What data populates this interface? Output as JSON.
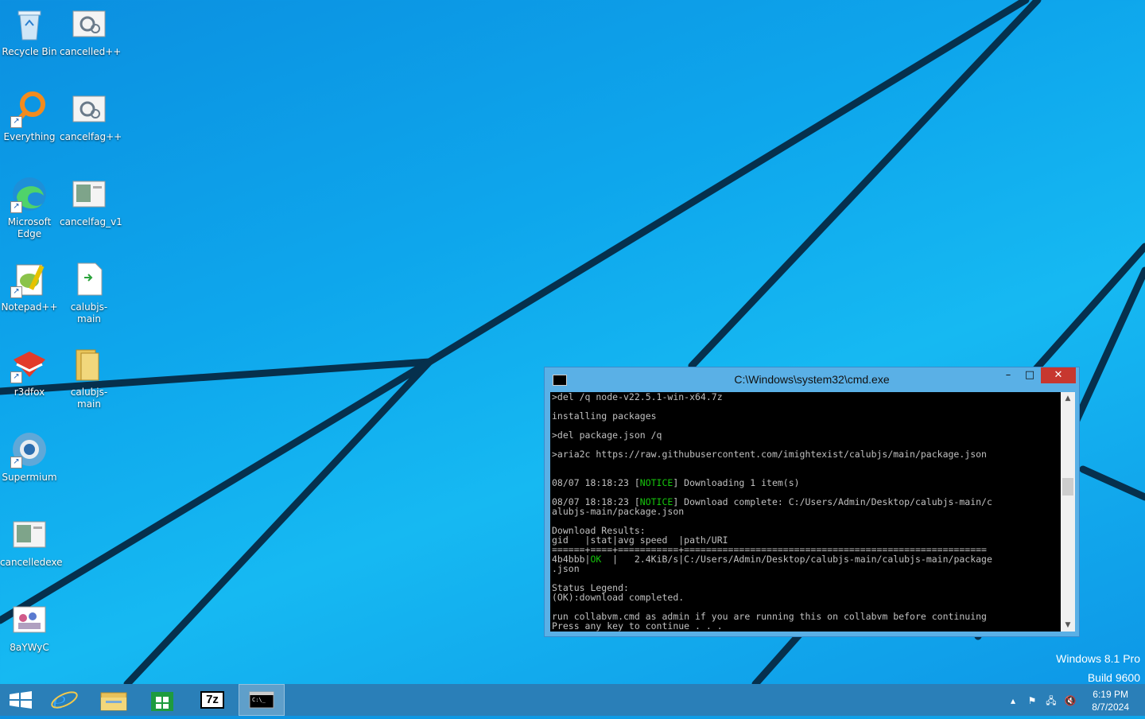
{
  "desktop": {
    "icons": [
      {
        "id": "recycle-bin",
        "label": "Recycle Bin",
        "icon": "recycle-bin-icon"
      },
      {
        "id": "cancelled-pp",
        "label": "cancelled++",
        "icon": "settings-file-icon"
      },
      {
        "id": "everything",
        "label": "Everything",
        "icon": "magnifier-icon"
      },
      {
        "id": "cancelfag-pp",
        "label": "cancelfag++",
        "icon": "settings-file-icon"
      },
      {
        "id": "edge",
        "label": "Microsoft Edge",
        "icon": "edge-icon"
      },
      {
        "id": "cancelfag-v1",
        "label": "cancelfag_v1",
        "icon": "window-file-icon"
      },
      {
        "id": "notepadpp",
        "label": "Notepad++",
        "icon": "notepadpp-icon"
      },
      {
        "id": "calubjs-main-script",
        "label": "calubjs-main",
        "icon": "script-file-icon"
      },
      {
        "id": "r3dfox",
        "label": "r3dfox",
        "icon": "r3dfox-icon"
      },
      {
        "id": "calubjs-main-folder",
        "label": "calubjs-main",
        "icon": "folder-icon"
      },
      {
        "id": "supermium",
        "label": "Supermium",
        "icon": "supermium-icon"
      },
      {
        "id": "cancelledexe",
        "label": "cancelledexe",
        "icon": "window-file-icon"
      },
      {
        "id": "8aywyc",
        "label": "8aYWyC",
        "icon": "image-file-icon"
      }
    ]
  },
  "cmd_window": {
    "title": "C:\\Windows\\system32\\cmd.exe",
    "minimize_label": "–",
    "maximize_label": "□",
    "close_label": "✕",
    "lines": [
      ">del /q node-v22.5.1-win-x64.7z",
      "",
      "installing packages",
      "",
      ">del package.json /q",
      "",
      ">aria2c https://raw.githubusercontent.com/imightexist/calubjs/main/package.json",
      "",
      "",
      "08/07 18:18:23 [NOTICE] Downloading 1 item(s)",
      "",
      "08/07 18:18:23 [NOTICE] Download complete: C:/Users/Admin/Desktop/calubjs-main/c",
      "alubjs-main/package.json",
      "",
      "Download Results:",
      "gid   |stat|avg speed  |path/URI",
      "======+====+===========+=======================================================",
      "4b4bbb|OK  |   2.4KiB/s|C:/Users/Admin/Desktop/calubjs-main/calubjs-main/package",
      ".json",
      "",
      "Status Legend:",
      "(OK):download completed.",
      "",
      "run collabvm.cmd as admin if you are running this on collabvm before continuing",
      "Press any key to continue . . ."
    ]
  },
  "watermark": {
    "edition": "Windows 8.1 Pro",
    "build": "Build 9600"
  },
  "taskbar": {
    "pinned": [
      {
        "id": "start",
        "icon": "windows-start-icon"
      },
      {
        "id": "ie",
        "icon": "internet-explorer-icon"
      },
      {
        "id": "explorer",
        "icon": "file-explorer-icon"
      },
      {
        "id": "store",
        "icon": "store-icon"
      },
      {
        "id": "7zip",
        "icon": "7zip-icon",
        "text": "7z"
      },
      {
        "id": "cmd",
        "icon": "cmd-icon",
        "active": true
      }
    ],
    "tray": {
      "time": "6:19 PM",
      "date": "8/7/2024",
      "icons": [
        "chevron-up-icon",
        "flag-icon",
        "network-icon",
        "volume-muted-icon"
      ]
    }
  },
  "colors": {
    "desktop_accent": "#0ea6ec",
    "console_bg": "#000000",
    "console_text": "#c0c0c0",
    "notice_green": "#16c60c",
    "close_red": "#c7372f"
  }
}
